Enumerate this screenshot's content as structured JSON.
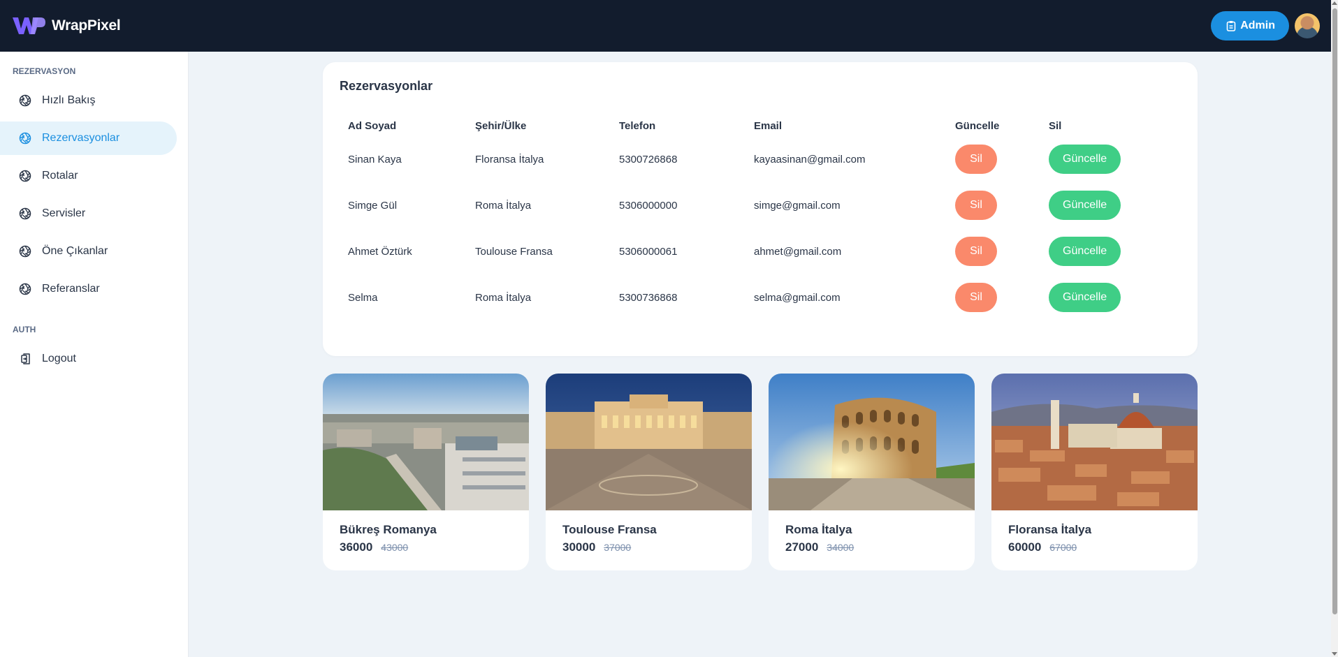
{
  "header": {
    "brand_name": "WrapPixel",
    "admin_label": "Admin"
  },
  "sidebar": {
    "section_reservation": "REZERVASYON",
    "items": [
      {
        "label": "Hızlı Bakış"
      },
      {
        "label": "Rezervasyonlar"
      },
      {
        "label": "Rotalar"
      },
      {
        "label": "Servisler"
      },
      {
        "label": "Öne Çıkanlar"
      },
      {
        "label": "Referanslar"
      }
    ],
    "section_auth": "AUTH",
    "logout_label": "Logout"
  },
  "reservations": {
    "title": "Rezervasyonlar",
    "columns": [
      "Ad Soyad",
      "Şehir/Ülke",
      "Telefon",
      "Email",
      "Güncelle",
      "Sil"
    ],
    "delete_label": "Sil",
    "update_label": "Güncelle",
    "rows": [
      {
        "name": "Sinan Kaya",
        "city": "Floransa İtalya",
        "phone": "5300726868",
        "email": "kayaasinan@gmail.com"
      },
      {
        "name": "Simge Gül",
        "city": "Roma İtalya",
        "phone": "5306000000",
        "email": "simge@gmail.com"
      },
      {
        "name": "Ahmet Öztürk",
        "city": "Toulouse Fransa",
        "phone": "5306000061",
        "email": "ahmet@gmail.com"
      },
      {
        "name": "Selma",
        "city": "Roma İtalya",
        "phone": "5300736868",
        "email": "selma@gmail.com"
      }
    ]
  },
  "destinations": [
    {
      "name": "Bükreş Romanya",
      "price": "36000",
      "old_price": "43000"
    },
    {
      "name": "Toulouse Fransa",
      "price": "30000",
      "old_price": "37000"
    },
    {
      "name": "Roma İtalya",
      "price": "27000",
      "old_price": "34000"
    },
    {
      "name": "Floransa İtalya",
      "price": "60000",
      "old_price": "67000"
    }
  ],
  "colors": {
    "header_bg": "#121c2d",
    "primary": "#1b8fe0",
    "active_bg": "#e5f3fb",
    "danger": "#fa896b",
    "success": "#3fce86",
    "page_bg": "#eef3f8"
  }
}
